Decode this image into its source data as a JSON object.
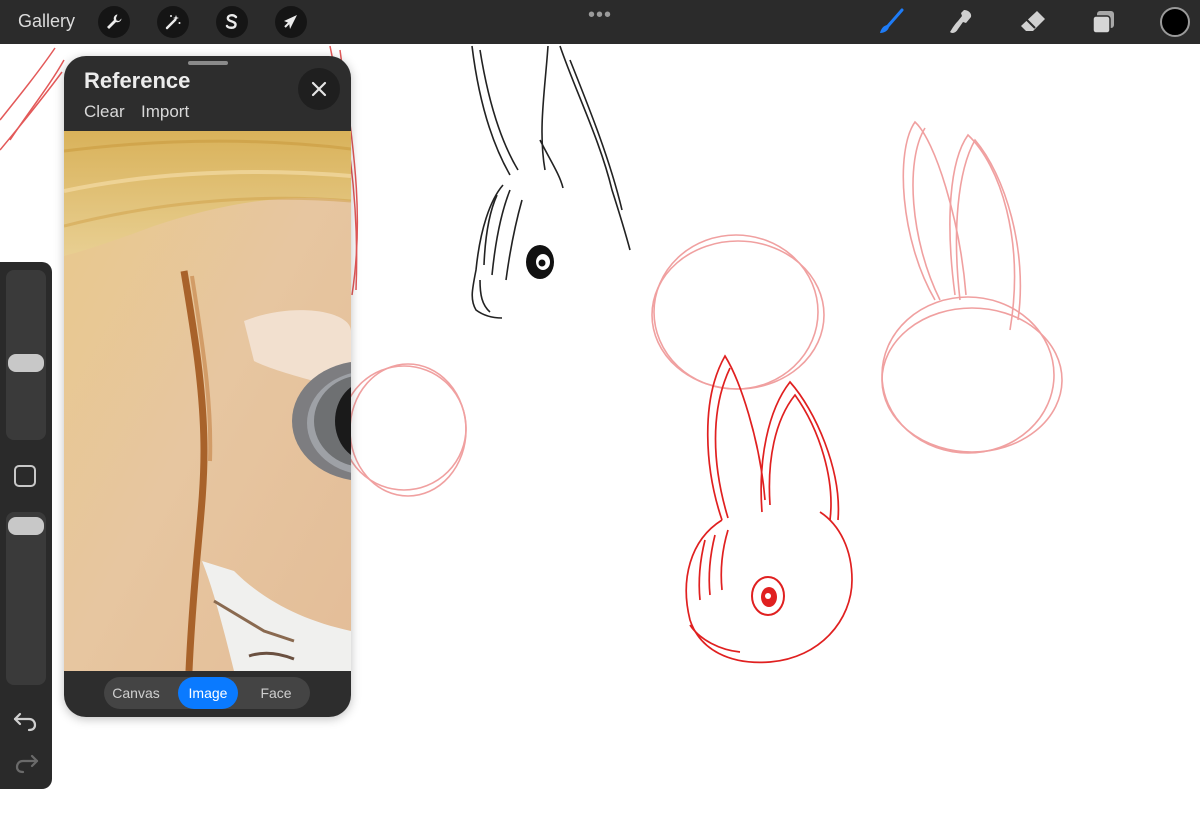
{
  "topbar": {
    "gallery_label": "Gallery",
    "actions_icon": "wrench-icon",
    "adjustments_icon": "magic-wand-icon",
    "selection_icon": "selection-s-icon",
    "transform_icon": "arrow-cursor-icon",
    "more_label": "•••",
    "brush_icon": "brush-icon",
    "smudge_icon": "smudge-icon",
    "eraser_icon": "eraser-icon",
    "layers_icon": "layers-icon",
    "color": "#000000",
    "active_tool_color": "#1e7cf7"
  },
  "reference": {
    "title": "Reference",
    "clear_label": "Clear",
    "import_label": "Import",
    "close_icon": "close-icon",
    "tabs": [
      {
        "label": "Canvas",
        "active": false
      },
      {
        "label": "Image",
        "active": true
      },
      {
        "label": "Face",
        "active": false
      }
    ]
  },
  "sidebar": {
    "brush_size_level": 0.45,
    "opacity_level": 0.95,
    "modify_icon": "square-modify-icon",
    "undo_icon": "undo-icon",
    "redo_icon": "redo-icon"
  }
}
